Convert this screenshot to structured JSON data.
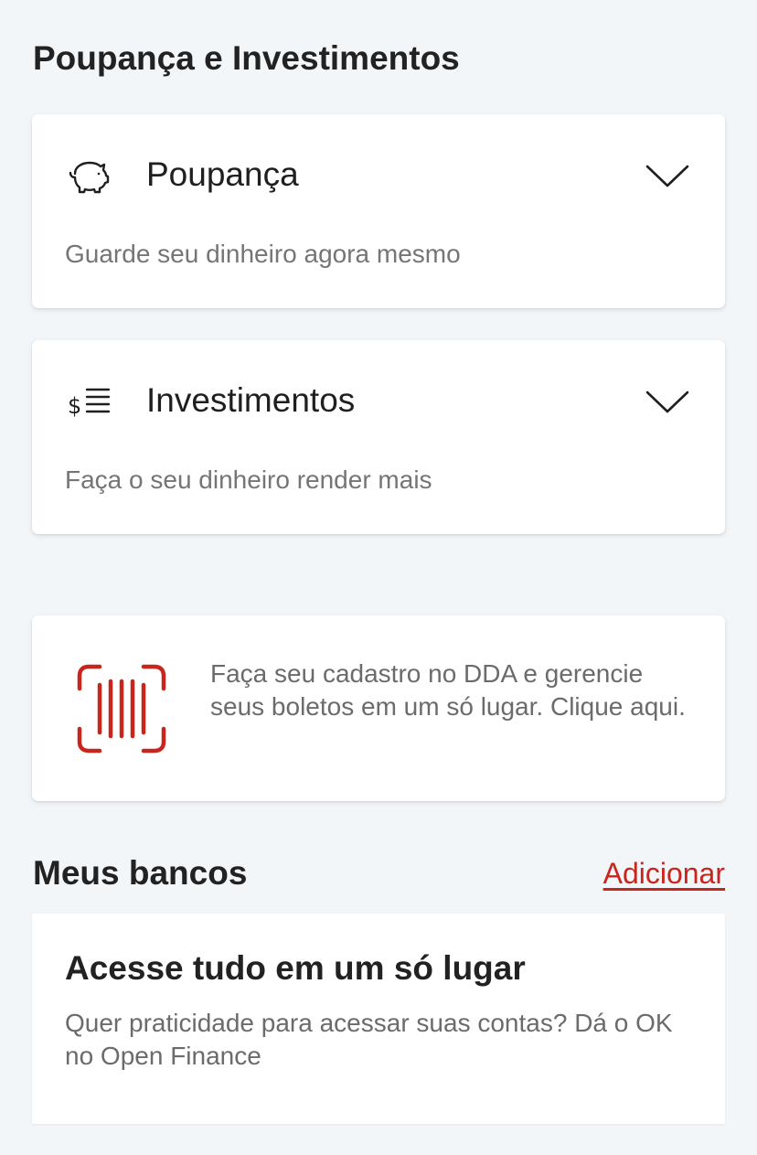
{
  "savings_investments": {
    "title": "Poupança e Investimentos",
    "cards": [
      {
        "icon": "piggy-bank-icon",
        "title": "Poupança",
        "subtitle": "Guarde seu dinheiro agora mesmo"
      },
      {
        "icon": "dollar-list-icon",
        "title": "Investimentos",
        "subtitle": "Faça o seu dinheiro render mais"
      }
    ]
  },
  "dda_banner": {
    "icon": "barcode-scan-icon",
    "text": "Faça seu cadastro no DDA e gerencie seus boletos em um só lugar. Clique aqui."
  },
  "banks": {
    "title": "Meus bancos",
    "add_label": "Adicionar",
    "card": {
      "title": "Acesse tudo em um só lugar",
      "text": "Quer praticidade para acessar suas contas? Dá o OK no Open Finance"
    }
  },
  "colors": {
    "accent": "#c8261c",
    "background": "#f3f6f9",
    "card": "#ffffff",
    "muted_text": "#757575"
  }
}
